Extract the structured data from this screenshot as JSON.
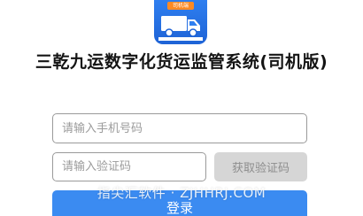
{
  "logo": {
    "tag_text": "司机端",
    "icon": "delivery-truck-icon",
    "colors": {
      "background": "#1e63d6",
      "tag": "#ff8a24"
    }
  },
  "app_title": "三乾九运数字化货运监管系统(司机版)",
  "form": {
    "phone_placeholder": "请输入手机号码",
    "code_placeholder": "请输入验证码",
    "get_code_label": "获取验证码",
    "login_label": "登录"
  },
  "watermark": "指尖汇软件 · ZJHHRJ.COM",
  "colors": {
    "primary": "#3b8bf1",
    "disabled_button": "#d6d6d6",
    "input_border": "#9a9a9a"
  }
}
